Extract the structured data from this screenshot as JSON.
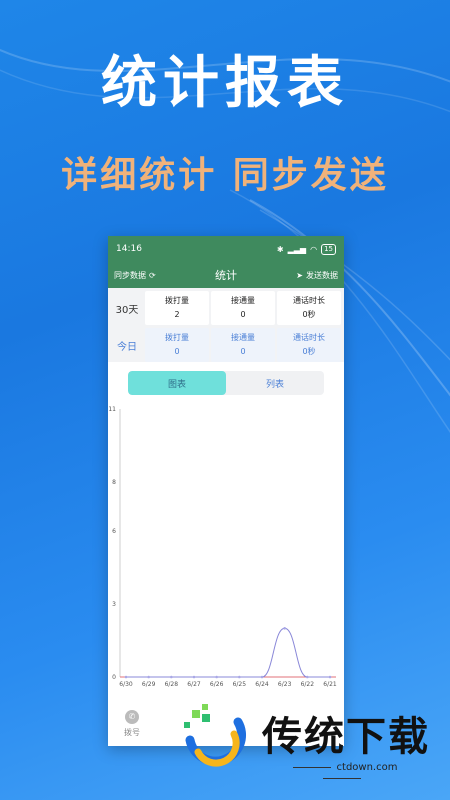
{
  "hero": {
    "title": "统计报表",
    "subtitle": "详细统计 同步发送"
  },
  "statusbar": {
    "time": "14:16",
    "battery": "15"
  },
  "appbar": {
    "left_label": "同步数据",
    "title": "统计",
    "right_label": "发送数据"
  },
  "stats": {
    "rows": [
      {
        "period": "30天",
        "cells": [
          {
            "label": "拨打量",
            "value": "2"
          },
          {
            "label": "接通量",
            "value": "0"
          },
          {
            "label": "通话时长",
            "value": "0秒"
          }
        ]
      },
      {
        "period": "今日",
        "cells": [
          {
            "label": "拨打量",
            "value": "0"
          },
          {
            "label": "接通量",
            "value": "0"
          },
          {
            "label": "通话时长",
            "value": "0秒"
          }
        ]
      }
    ]
  },
  "view_toggle": {
    "options": [
      "图表",
      "列表"
    ],
    "selected": "图表"
  },
  "chart_data": {
    "type": "line",
    "categories": [
      "6/30",
      "6/29",
      "6/28",
      "6/27",
      "6/26",
      "6/25",
      "6/24",
      "6/23",
      "6/22",
      "6/21"
    ],
    "series": [
      {
        "values": [
          0,
          0,
          0,
          0,
          0,
          0,
          0,
          2,
          0,
          0
        ]
      }
    ],
    "y_ticks": [
      "11",
      "8",
      "6",
      "3",
      "0"
    ],
    "ylim": [
      0,
      11
    ],
    "colors": {
      "line": "#8a88d8",
      "baseline": "#e0707a"
    }
  },
  "bottom_nav": {
    "items": [
      {
        "label": "拨号",
        "icon": "phone-icon"
      }
    ]
  },
  "watermark": {
    "text": "传统下载",
    "url": "ctdown.com"
  },
  "colors": {
    "header_green": "#3f8a5e",
    "accent_blue": "#4a7fd6",
    "toggle_active": "#6fe0db",
    "subtitle_orange": "#f0b27a"
  }
}
